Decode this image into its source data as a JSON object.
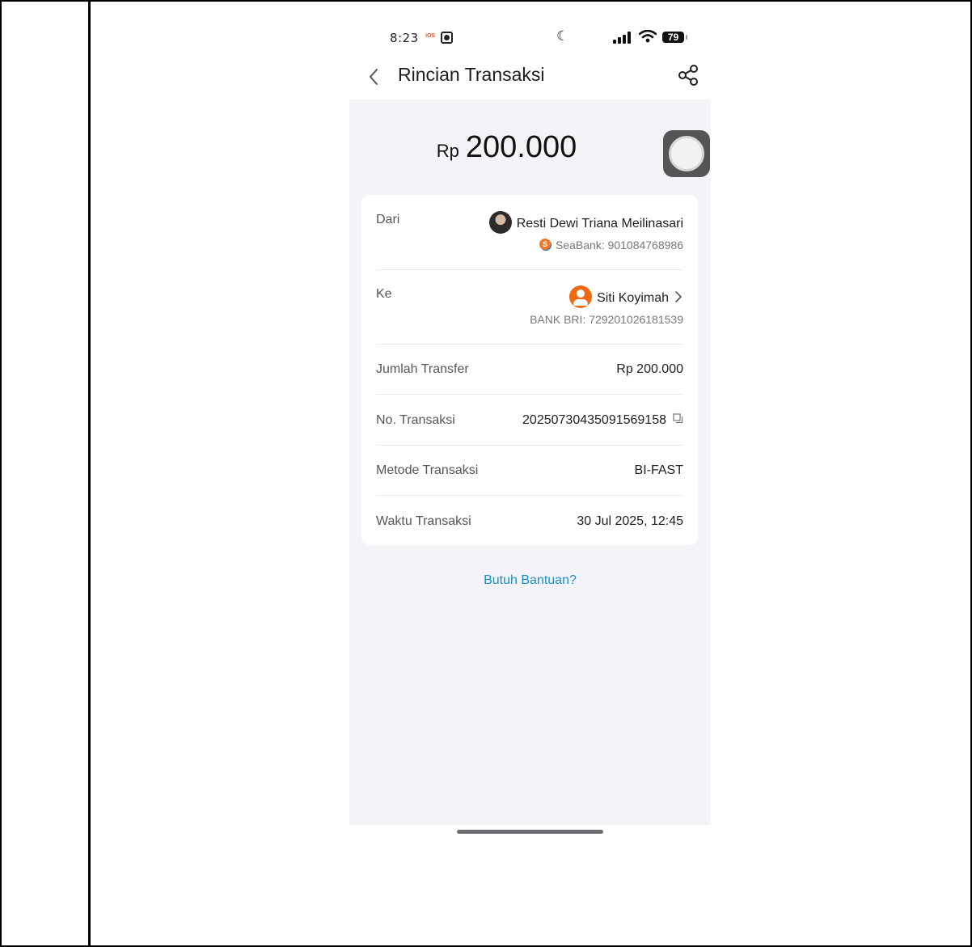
{
  "status_bar": {
    "time": "8:23",
    "ios_badge": "iOS",
    "battery": "79"
  },
  "header": {
    "title": "Rincian Transaksi",
    "back_icon": "chevron-left-icon",
    "share_icon": "share-icon"
  },
  "amount": {
    "currency": "Rp",
    "value": "200.000"
  },
  "details": {
    "from": {
      "label": "Dari",
      "name": "Resti Dewi Triana Meilinasari",
      "account": "SeaBank: 901084768986"
    },
    "to": {
      "label": "Ke",
      "name": "Siti Koyimah",
      "account": "BANK BRI: 729201026181539"
    },
    "transfer_amount": {
      "label": "Jumlah Transfer",
      "value": "Rp 200.000"
    },
    "transaction_no": {
      "label": "No. Transaksi",
      "value": "20250730435091569158"
    },
    "method": {
      "label": "Metode Transaksi",
      "value": "BI-FAST"
    },
    "time": {
      "label": "Waktu Transaksi",
      "value": "30 Jul 2025, 12:45"
    }
  },
  "help": {
    "label": "Butuh Bantuan?"
  },
  "colors": {
    "accent_link": "#1b8ec7",
    "avatar_orange": "#f06a13",
    "background": "#f4f4f8"
  }
}
